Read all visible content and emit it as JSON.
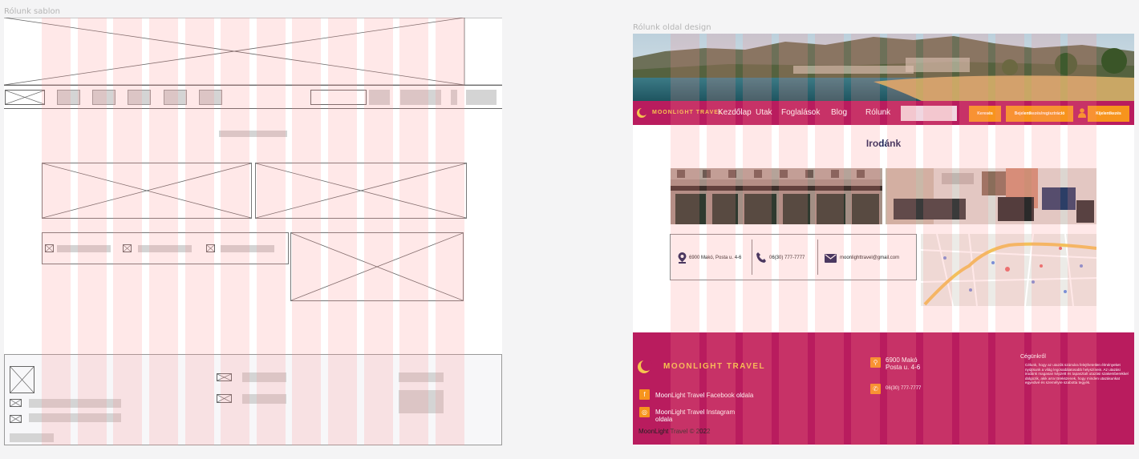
{
  "wireframe": {
    "label": "Rólunk sablon"
  },
  "design": {
    "label": "Rólunk oldal design",
    "nav": {
      "brand": "MOONLIGHT TRAVEL",
      "links": [
        "Kezdőlap",
        "Utak",
        "Foglalások",
        "Blog",
        "Rólunk"
      ],
      "search_btn": "Keresés",
      "register_btn": "Bejelentkezés/regisztráció",
      "logout_btn": "Kijelentkezés"
    },
    "page_title": "Irodánk",
    "contact": {
      "address": "6900 Makó, Posta u. 4-6",
      "phone": "06(30) 777-7777",
      "email": "moonlighttravel@gmail.com"
    },
    "footer": {
      "brand": "MOONLIGHT TRAVEL",
      "facebook": "MoonLight Travel Facebook oldala",
      "instagram_line1": "MoonLight Travel Instagram",
      "instagram_line2": "oldala",
      "copyright": "MoonLight Travel © 2022",
      "address_line1": "6900 Makó",
      "address_line2": "Posta u. 4-6",
      "phone": "06(30) 777-7777",
      "about_title": "Cégünkről",
      "about_text": "Célunk, hogy az utazók számára felejthetetlen élményeket nyújtsunk a világ legcsodálatosabb helyszínein. Az utazási irodánk magasan képzett és tapasztalt utazási szakemberekkel dolgozik, akik arra törekszenek, hogy minden utazásunkat egyedivé és személyre szabotta tegyék."
    }
  },
  "colors": {
    "brand_magenta": "#b91c5e",
    "accent_orange": "#f7941d",
    "grid_overlay": "rgba(255,140,140,0.2)"
  }
}
